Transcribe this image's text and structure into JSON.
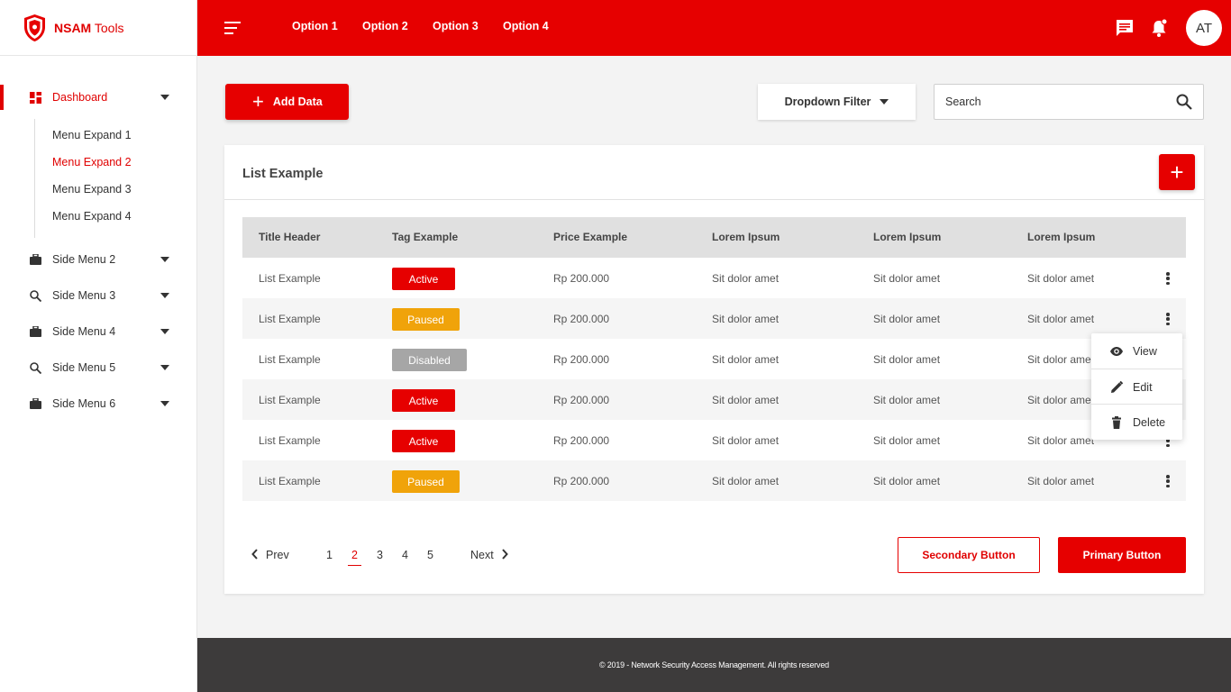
{
  "app": {
    "brand_bold": "NSAM",
    "brand_rest": " Tools"
  },
  "sidebar": {
    "dashboard": "Dashboard",
    "sub_items": [
      "Menu Expand 1",
      "Menu Expand 2",
      "Menu Expand 3",
      "Menu Expand 4"
    ],
    "menus": [
      "Side Menu 2",
      "Side Menu 3",
      "Side Menu 4",
      "Side Menu 5",
      "Side Menu 6"
    ]
  },
  "topbar": {
    "options": [
      "Option 1",
      "Option 2",
      "Option 3",
      "Option 4"
    ],
    "avatar": "AT"
  },
  "toolbar": {
    "add_label": "Add Data",
    "dropdown_label": "Dropdown Filter",
    "search_placeholder": "Search"
  },
  "card": {
    "title": "List Example",
    "headers": [
      "Title Header",
      "Tag Example",
      "Price Example",
      "Lorem Ipsum",
      "Lorem Ipsum",
      "Lorem Ipsum"
    ],
    "rows": [
      {
        "title": "List Example",
        "tag": "Active",
        "price": "Rp 200.000",
        "c1": "Sit dolor amet",
        "c2": "Sit dolor amet",
        "c3": "Sit dolor amet"
      },
      {
        "title": "List Example",
        "tag": "Paused",
        "price": "Rp 200.000",
        "c1": "Sit dolor amet",
        "c2": "Sit dolor amet",
        "c3": "Sit dolor amet"
      },
      {
        "title": "List Example",
        "tag": "Disabled",
        "price": "Rp 200.000",
        "c1": "Sit dolor amet",
        "c2": "Sit dolor amet",
        "c3": "Sit dolor amet"
      },
      {
        "title": "List Example",
        "tag": "Active",
        "price": "Rp 200.000",
        "c1": "Sit dolor amet",
        "c2": "Sit dolor amet",
        "c3": "Sit dolor amet"
      },
      {
        "title": "List Example",
        "tag": "Active",
        "price": "Rp 200.000",
        "c1": "Sit dolor amet",
        "c2": "Sit dolor amet",
        "c3": "Sit dolor amet"
      },
      {
        "title": "List Example",
        "tag": "Paused",
        "price": "Rp 200.000",
        "c1": "Sit dolor amet",
        "c2": "Sit dolor amet",
        "c3": "Sit dolor amet"
      }
    ],
    "context_menu": [
      "View",
      "Edit",
      "Delete"
    ]
  },
  "pagination": {
    "prev": "Prev",
    "next": "Next",
    "pages": [
      "1",
      "2",
      "3",
      "4",
      "5"
    ],
    "current": "2"
  },
  "buttons": {
    "secondary": "Secondary Button",
    "primary": "Primary Button"
  },
  "footer": {
    "text": "© 2019 - Network Security Access Management. All rights reserved"
  },
  "colors": {
    "brand_red": "#e60000",
    "paused": "#f0a30a",
    "disabled": "#a6a6a6",
    "footer_bg": "#3d3b3b"
  }
}
